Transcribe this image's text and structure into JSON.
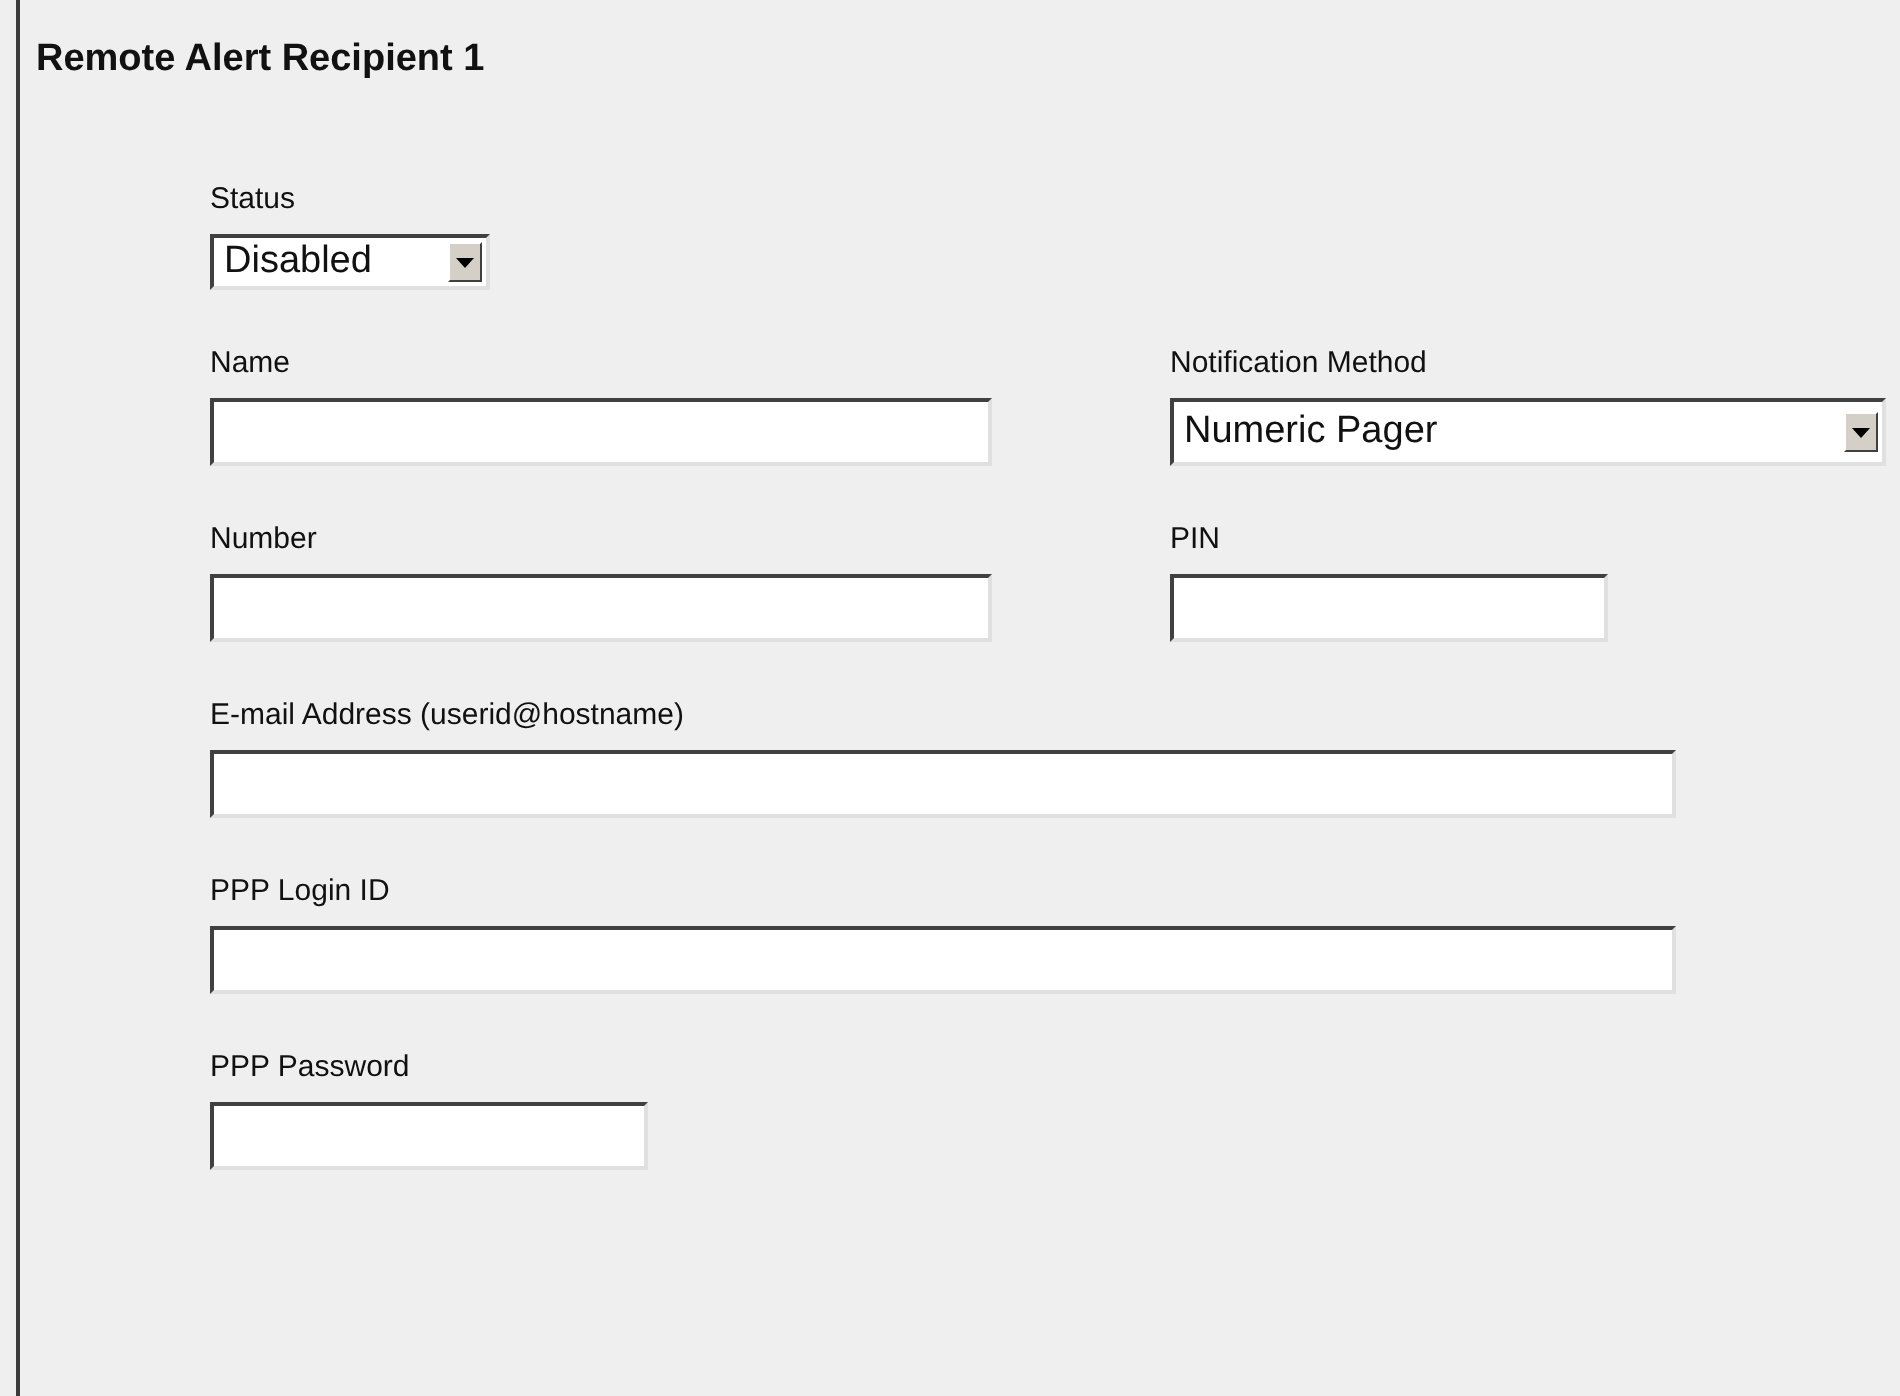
{
  "title": "Remote Alert Recipient 1",
  "status": {
    "label": "Status",
    "value": "Disabled"
  },
  "name": {
    "label": "Name"
  },
  "notification_method": {
    "label": "Notification Method",
    "value": "Numeric Pager"
  },
  "number": {
    "label": "Number"
  },
  "pin": {
    "label": "PIN"
  },
  "email": {
    "label": "E-mail Address (userid@hostname)"
  },
  "ppp_login_id": {
    "label": "PPP Login ID"
  },
  "ppp_password": {
    "label": "PPP Password"
  }
}
